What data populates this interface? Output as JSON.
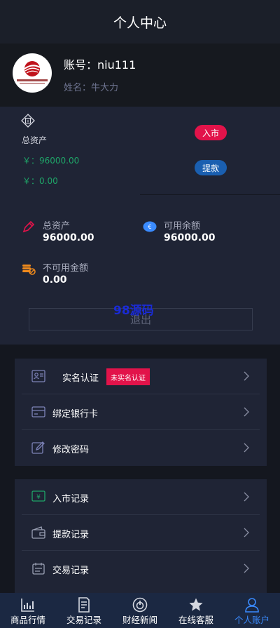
{
  "header": {
    "title": "个人中心"
  },
  "profile": {
    "account": "账号：niu111",
    "name": "姓名：牛大力",
    "logo_text": "上海新东交易所"
  },
  "assets": {
    "total_label": "总资产",
    "total_value": "￥：96000.00",
    "frozen_value": "￥：0.00",
    "deposit_label": "入市",
    "withdraw_label": "提款"
  },
  "stats": {
    "total_assets": {
      "label": "总资产",
      "value": "96000.00"
    },
    "available": {
      "label": "可用余额",
      "value": "96000.00"
    },
    "unavailable": {
      "label": "不可用金额",
      "value": "0.00"
    }
  },
  "watermark": "98源码",
  "logout_label": "退出",
  "account_menu": {
    "items": [
      {
        "label": "实名认证",
        "badge": "未实名认证",
        "icon": "id-card-icon"
      },
      {
        "label": "绑定银行卡",
        "icon": "bank-card-icon"
      },
      {
        "label": "修改密码",
        "icon": "edit-icon"
      }
    ]
  },
  "records_menu": {
    "items": [
      {
        "label": "入市记录",
        "icon": "yen-deposit-icon"
      },
      {
        "label": "提款记录",
        "icon": "wallet-icon"
      },
      {
        "label": "交易记录",
        "icon": "calendar-icon"
      }
    ]
  },
  "tabbar": {
    "tabs": [
      {
        "label": "商品行情",
        "icon": "chart-icon"
      },
      {
        "label": "交易记录",
        "icon": "document-icon"
      },
      {
        "label": "财经新闻",
        "icon": "power-icon"
      },
      {
        "label": "在线客服",
        "icon": "star-icon"
      },
      {
        "label": "个人账户",
        "icon": "user-icon",
        "active": true
      }
    ]
  },
  "colors": {
    "accent_red": "#e2134a",
    "accent_blue": "#1a5fb0",
    "positive_green": "#1fa568",
    "active_tab": "#3a8bff"
  }
}
